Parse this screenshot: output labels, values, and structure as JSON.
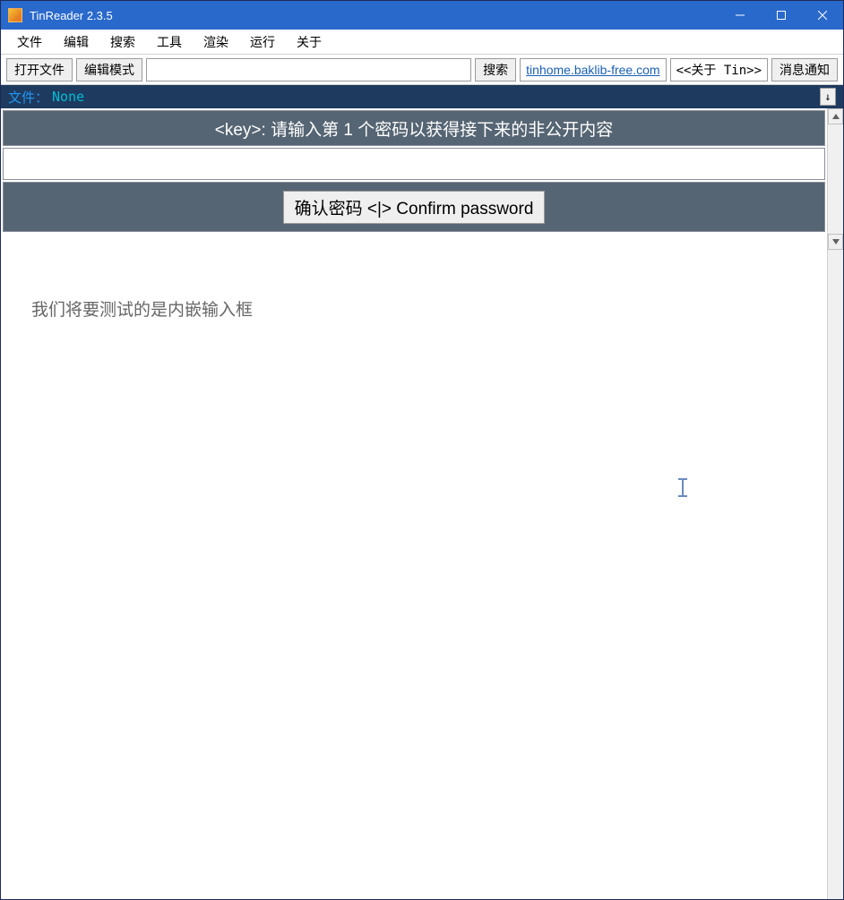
{
  "window": {
    "title": "TinReader 2.3.5"
  },
  "menu": {
    "items": [
      "文件",
      "编辑",
      "搜索",
      "工具",
      "渲染",
      "运行",
      "关于"
    ]
  },
  "toolbar": {
    "open_file": "打开文件",
    "edit_mode": "编辑模式",
    "search_value": "",
    "search_button": "搜索",
    "home_link": "tinhome.baklib-free.com",
    "about_tin": "<<关于 Tin>>",
    "notifications": "消息通知"
  },
  "filebar": {
    "label": "文件：",
    "name": "None",
    "arrow": "↓"
  },
  "prompt": {
    "key_banner": "<key>: 请输入第 1 个密码以获得接下来的非公开内容",
    "confirm_button": "确认密码 <|> Confirm password"
  },
  "body": {
    "paragraph": "我们将要测试的是内嵌输入框"
  }
}
